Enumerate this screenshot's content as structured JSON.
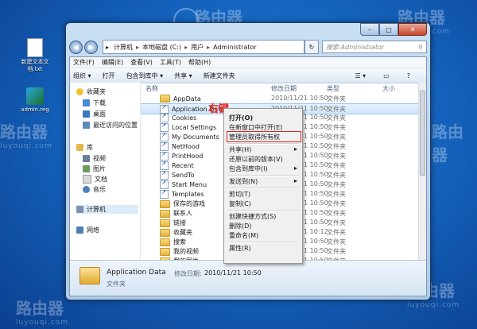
{
  "desktop": {
    "icons": [
      {
        "label": "新建文本文档.txt",
        "icon": "text-file-icon"
      },
      {
        "label": "admin.reg",
        "icon": "registry-file-icon"
      }
    ],
    "watermark": {
      "brand": "路由器",
      "url": "luyouqi.com"
    }
  },
  "window": {
    "controls": {
      "minimize": "–",
      "maximize": "□",
      "close": "✕"
    },
    "nav": {
      "back": "◀",
      "forward": "▶"
    },
    "address": [
      "计算机",
      "本地磁盘 (C:)",
      "用户",
      "Administrator"
    ],
    "refresh": "↻",
    "search_placeholder": "搜索 Administrator",
    "menu": [
      "文件(F)",
      "编辑(E)",
      "查看(V)",
      "工具(T)",
      "帮助(H)"
    ],
    "toolbar": [
      "组织 ▾",
      "打开",
      "包含到库中 ▾",
      "共享 ▾",
      "新建文件夹"
    ],
    "toolbar_right": [
      "☰ ▾",
      "▭",
      "?"
    ],
    "nav_pane": {
      "favorites": "收藏夹",
      "favorite_items": [
        "下载",
        "桌面",
        "最近访问的位置"
      ],
      "libraries": "库",
      "library_items": [
        "视频",
        "图片",
        "文档",
        "音乐"
      ],
      "computer": "计算机",
      "network": "网络"
    },
    "columns": {
      "name": "名称",
      "date": "修改日期",
      "type": "类型",
      "size": "大小"
    },
    "files": [
      {
        "name": "AppData",
        "date": "2010/11/21 10:50",
        "type": "文件夹",
        "kind": "folder"
      },
      {
        "name": "Application Data",
        "date": "2010/11/21 10:50",
        "type": "文件夹",
        "kind": "shortcut"
      },
      {
        "name": "Cookies",
        "date": "2010/11/21 10:50",
        "type": "文件夹",
        "kind": "shortcut"
      },
      {
        "name": "Local Settings",
        "date": "2010/11/21 10:50",
        "type": "文件夹",
        "kind": "shortcut"
      },
      {
        "name": "My Documents",
        "date": "2010/11/21 10:50",
        "type": "文件夹",
        "kind": "shortcut"
      },
      {
        "name": "NetHood",
        "date": "2010/11/21 10:50",
        "type": "文件夹",
        "kind": "shortcut"
      },
      {
        "name": "PrintHood",
        "date": "2010/11/21 10:50",
        "type": "文件夹",
        "kind": "shortcut"
      },
      {
        "name": "Recent",
        "date": "2010/11/21 10:50",
        "type": "文件夹",
        "kind": "shortcut"
      },
      {
        "name": "SendTo",
        "date": "2010/11/21 10:50",
        "type": "文件夹",
        "kind": "shortcut"
      },
      {
        "name": "Start Menu",
        "date": "2010/11/21 10:50",
        "type": "文件夹",
        "kind": "shortcut"
      },
      {
        "name": "Templates",
        "date": "2010/11/21 10:50",
        "type": "文件夹",
        "kind": "shortcut"
      },
      {
        "name": "保存的游戏",
        "date": "2010/11/21 10:50",
        "type": "文件夹",
        "kind": "folder"
      },
      {
        "name": "联系人",
        "date": "2010/11/21 10:50",
        "type": "文件夹",
        "kind": "folder"
      },
      {
        "name": "链接",
        "date": "2010/11/21 10:50",
        "type": "文件夹",
        "kind": "folder"
      },
      {
        "name": "收藏夹",
        "date": "2010/11/21 10:12",
        "type": "文件夹",
        "kind": "folder"
      },
      {
        "name": "搜索",
        "date": "2010/11/21 10:50",
        "type": "文件夹",
        "kind": "folder"
      },
      {
        "name": "我的视频",
        "date": "2010/11/21 10:50",
        "type": "文件夹",
        "kind": "folder"
      },
      {
        "name": "我的图片",
        "date": "2010/11/21 10:50",
        "type": "文件夹",
        "kind": "folder"
      },
      {
        "name": "我的文档",
        "date": "2010/11/21 10:50",
        "type": "文件夹",
        "kind": "folder"
      }
    ],
    "details": {
      "name": "Application Data",
      "modified_label": "修改日期:",
      "modified": "2010/11/21 10:50",
      "type": "文件夹"
    }
  },
  "annotation": "右键",
  "context_menu": [
    {
      "label": "打开(O)",
      "bold": true
    },
    {
      "label": "在新窗口中打开(E)"
    },
    {
      "label": "管理员取得所有权",
      "highlight": true
    },
    {
      "sep": true
    },
    {
      "label": "共享(H)",
      "arrow": true
    },
    {
      "label": "还原以前的版本(V)"
    },
    {
      "label": "包含到库中(I)",
      "arrow": true
    },
    {
      "sep": true
    },
    {
      "label": "发送到(N)",
      "arrow": true
    },
    {
      "sep": true
    },
    {
      "label": "剪切(T)"
    },
    {
      "label": "复制(C)"
    },
    {
      "sep": true
    },
    {
      "label": "创建快捷方式(S)"
    },
    {
      "label": "删除(D)"
    },
    {
      "label": "重命名(M)"
    },
    {
      "sep": true
    },
    {
      "label": "属性(R)"
    }
  ],
  "colors": {
    "highlight_box": "#e02020",
    "annotation": "#e5281f",
    "selection": "#cfe6fb"
  }
}
